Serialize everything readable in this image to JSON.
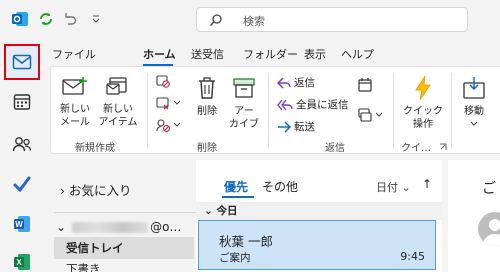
{
  "titlebar": {
    "search_placeholder": "検索"
  },
  "menu": {
    "items": [
      "ファイル",
      "ホーム",
      "送受信",
      "フォルダー",
      "表示",
      "ヘルプ"
    ]
  },
  "ribbon": {
    "new_mail": "新しい\nメール",
    "new_item": "新しい\nアイテム",
    "group_new": "新規作成",
    "delete": "削除",
    "archive": "アー\nカイブ",
    "group_delete": "削除",
    "reply": "返信",
    "reply_all": "全員に返信",
    "forward": "転送",
    "group_respond": "返信",
    "quick_steps": "クイック\n操作",
    "group_quick": "クイ…",
    "move": "移動"
  },
  "folders": {
    "favorites": "お気に入り",
    "account_suffix": "@o…",
    "items": [
      "受信トレイ",
      "下書き"
    ]
  },
  "messages": {
    "tabs": [
      "優先",
      "その他"
    ],
    "sort": "日付",
    "group_today": "今日",
    "mail": {
      "from": "秋葉 一郎",
      "subject": "ご案内",
      "time": "9:45"
    }
  },
  "reading": {
    "text": "ご"
  },
  "colors": {
    "accent": "#0f6cbd",
    "highlight_border": "#e3000f",
    "selected_mail": "#cce3f8"
  }
}
